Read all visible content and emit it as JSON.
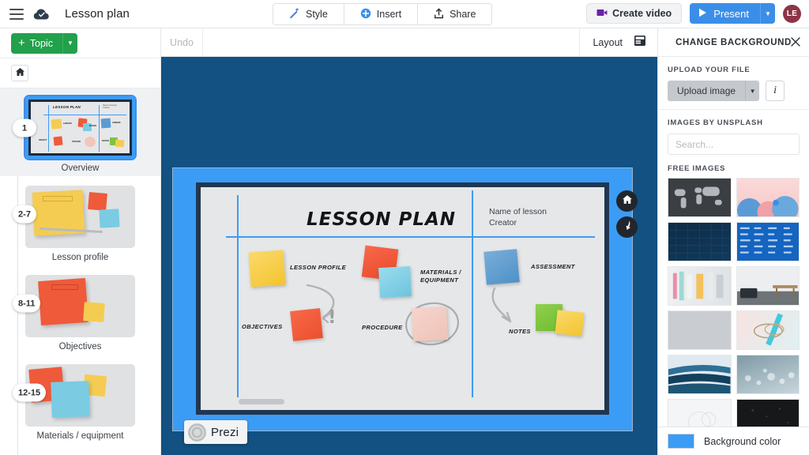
{
  "topbar": {
    "menu_icon": "hamburger-icon",
    "cloud_icon": "cloud-saved-icon",
    "title": "Lesson plan",
    "buttons": [
      {
        "label": "Style",
        "icon": "magic-wand-icon"
      },
      {
        "label": "Insert",
        "icon": "plus-circle-icon"
      },
      {
        "label": "Share",
        "icon": "share-upload-icon"
      }
    ],
    "create_video_label": "Create video",
    "create_video_icon": "video-camera-icon",
    "present_label": "Present",
    "present_icon": "play-icon",
    "present_caret": "▼",
    "avatar_initials": "LE",
    "avatar_color": "#8e3448",
    "present_color": "#3b8ee8",
    "create_video_icon_color": "#6b21a8"
  },
  "sidebar": {
    "topic_label": "Topic",
    "topic_plus": "+",
    "topic_caret": "▼",
    "topic_color": "#22a04b",
    "home_icon": "home-icon",
    "thumbnails": [
      {
        "badge": "1",
        "caption": "Overview",
        "selected": true
      },
      {
        "badge": "2-7",
        "caption": "Lesson profile",
        "selected": false
      },
      {
        "badge": "8-11",
        "caption": "Objectives",
        "selected": false
      },
      {
        "badge": "12-15",
        "caption": "Materials / equipment",
        "selected": false
      }
    ]
  },
  "canvas_toolbar": {
    "undo_label": "Undo",
    "layout_label": "Layout",
    "layout_icon": "layout-template-icon"
  },
  "slide": {
    "title": "LESSON PLAN",
    "creator_text": "Name of lesson\nCreator",
    "labels": [
      "LESSON PROFILE",
      "MATERIALS /\nEQUIPMENT",
      "ASSESSMENT",
      "OBJECTIVES",
      "PROCEDURE",
      "NOTES"
    ],
    "watermark": "Prezi",
    "watermark_icon": "prezi-logo-icon",
    "nav_home_icon": "home-icon",
    "nav_back_icon": "back-arrow-icon",
    "background_color": "#125182",
    "frame_color": "#3b9cf5"
  },
  "right_panel": {
    "title": "CHANGE BACKGROUND",
    "close_icon": "close-icon",
    "upload_section_label": "UPLOAD YOUR FILE",
    "upload_button_label": "Upload image",
    "upload_caret": "▼",
    "info_button_label": "i",
    "unsplash_section_label": "IMAGES BY UNSPLASH",
    "search_placeholder": "Search...",
    "search_value": "",
    "search_icon": "search-icon",
    "free_images_label": "FREE IMAGES",
    "free_images": [
      "world-map-dark",
      "pink-blue-spheres",
      "dark-blue-texture",
      "blue-data-numbers",
      "colorful-interior",
      "white-room-table",
      "plain-gray",
      "teal-abstract-flower",
      "blue-wave-motion",
      "water-droplets-bokeh",
      "light-sketch",
      "black-texture"
    ],
    "background_color_label": "Background color",
    "background_color_value": "#3b9cf5"
  }
}
